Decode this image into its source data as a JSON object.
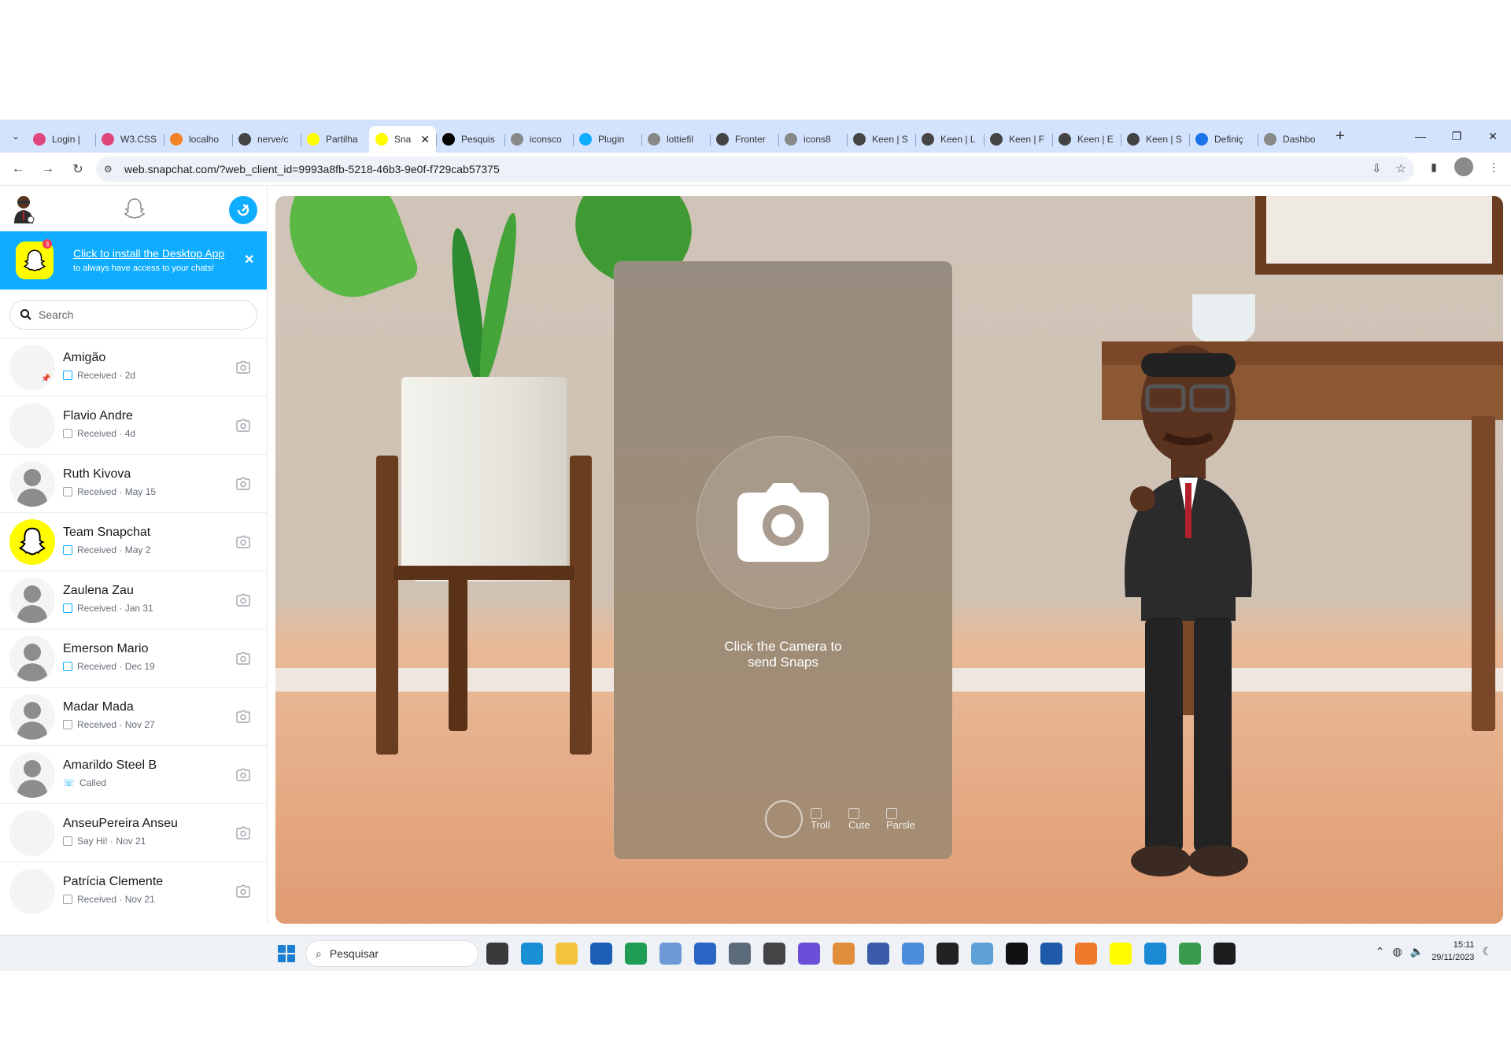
{
  "browser": {
    "tabs": [
      {
        "label": "Login |",
        "color": "#e0457b",
        "icon": "w3-icon"
      },
      {
        "label": "W3.CSS",
        "color": "#e0457b",
        "icon": "w3-icon"
      },
      {
        "label": "localho",
        "color": "#f48024",
        "icon": "xampp-icon"
      },
      {
        "label": "nerve/c",
        "color": "#444444",
        "icon": "globe-icon"
      },
      {
        "label": "Partilha",
        "color": "#fffc00",
        "icon": "snapchat-icon"
      },
      {
        "label": "Sna",
        "color": "#fffc00",
        "icon": "snapchat-icon",
        "active": true
      },
      {
        "label": "Pesquis",
        "color": "#000000",
        "icon": "threads-icon"
      },
      {
        "label": "iconsco",
        "color": "#888888",
        "icon": "globe-icon"
      },
      {
        "label": "Plugin",
        "color": "#0eadff",
        "icon": "search-icon"
      },
      {
        "label": "lottiefil",
        "color": "#888888",
        "icon": "globe-icon"
      },
      {
        "label": "Fronter",
        "color": "#444444",
        "icon": "globe-icon"
      },
      {
        "label": "icons8",
        "color": "#888888",
        "icon": "globe-icon"
      },
      {
        "label": "Keen | S",
        "color": "#444444",
        "icon": "globe-icon"
      },
      {
        "label": "Keen | L",
        "color": "#444444",
        "icon": "globe-icon"
      },
      {
        "label": "Keen | F",
        "color": "#444444",
        "icon": "globe-icon"
      },
      {
        "label": "Keen | E",
        "color": "#444444",
        "icon": "globe-icon"
      },
      {
        "label": "Keen | S",
        "color": "#444444",
        "icon": "globe-icon"
      },
      {
        "label": "Definiç",
        "color": "#1a73e8",
        "icon": "gear-icon"
      },
      {
        "label": "Dashbo",
        "color": "#888888",
        "icon": "globe-icon"
      }
    ],
    "active_tab_close": "✕",
    "new_tab": "+",
    "url": "web.snapchat.com/?web_client_id=9993a8fb-5218-46b3-9e0f-f729cab57375"
  },
  "sidebar": {
    "banner": {
      "title": "Click to install the Desktop App",
      "subtitle": "to always have access to your chats!",
      "badge": "3"
    },
    "search": {
      "placeholder": "Search"
    },
    "chats": [
      {
        "name": "Amigão",
        "status": "Received · 2d",
        "kind": "received-blue",
        "avatar": "blank",
        "pinned": true
      },
      {
        "name": "Flavio Andre",
        "status": "Received · 4d",
        "kind": "received-grey",
        "avatar": "blank"
      },
      {
        "name": "Ruth Kivova",
        "status": "Received · May 15",
        "kind": "received-grey",
        "avatar": "silhouette"
      },
      {
        "name": "Team Snapchat",
        "status": "Received · May 2",
        "kind": "received-blue",
        "avatar": "snapchat"
      },
      {
        "name": "Zaulena Zau",
        "status": "Received · Jan 31",
        "kind": "received-blue",
        "avatar": "silhouette"
      },
      {
        "name": "Emerson Mario",
        "status": "Received · Dec 19",
        "kind": "received-blue",
        "avatar": "silhouette"
      },
      {
        "name": "Madar Mada",
        "status": "Received · Nov 27",
        "kind": "received-grey",
        "avatar": "silhouette"
      },
      {
        "name": "Amarildo Steel B",
        "status": "Called",
        "kind": "called",
        "avatar": "silhouette"
      },
      {
        "name": "AnseuPereira Anseu",
        "status": "Say Hi! · Nov 21",
        "kind": "received-grey",
        "avatar": "blank"
      },
      {
        "name": "Patrícia Clemente",
        "status": "Received · Nov 21",
        "kind": "received-grey",
        "avatar": "blank"
      }
    ]
  },
  "camera": {
    "line1": "Click the Camera to",
    "line2": "send Snaps",
    "lenses": [
      "Troll",
      "Cute",
      "Parsle"
    ]
  },
  "taskbar": {
    "search_label": "Pesquisar",
    "time": "15:11",
    "date": "29/11/2023",
    "apps": [
      {
        "name": "task-view-icon",
        "color": "#3a3a3a"
      },
      {
        "name": "edge-icon",
        "color": "#1b8fd6"
      },
      {
        "name": "file-explorer-icon",
        "color": "#f4c23b"
      },
      {
        "name": "store-icon",
        "color": "#1d5fb6"
      },
      {
        "name": "sheets-icon",
        "color": "#1f9d55"
      },
      {
        "name": "photos-icon",
        "color": "#6d9ad6"
      },
      {
        "name": "word-icon",
        "color": "#2b66c4"
      },
      {
        "name": "camera-app-icon",
        "color": "#5c6b7a"
      },
      {
        "name": "terminal-app-icon",
        "color": "#444444"
      },
      {
        "name": "circle-app-icon",
        "color": "#6b4fd8"
      },
      {
        "name": "diamond-app-icon",
        "color": "#e08d3c"
      },
      {
        "name": "remote-app-icon",
        "color": "#3b5ca8"
      },
      {
        "name": "settings-app-icon",
        "color": "#4c8ed9"
      },
      {
        "name": "cmd-icon",
        "color": "#222222"
      },
      {
        "name": "control-panel-icon",
        "color": "#5fa0d6"
      },
      {
        "name": "netflix-icon",
        "color": "#111111"
      },
      {
        "name": "photoshop-icon",
        "color": "#1e5aa8"
      },
      {
        "name": "xampp-icon",
        "color": "#f07a2b"
      },
      {
        "name": "snapchat-icon",
        "color": "#fffc00"
      },
      {
        "name": "vscode-icon",
        "color": "#1a8ad4"
      },
      {
        "name": "chrome-icon",
        "color": "#3a9b4d"
      },
      {
        "name": "media-player-icon",
        "color": "#1c1c1c"
      }
    ]
  }
}
